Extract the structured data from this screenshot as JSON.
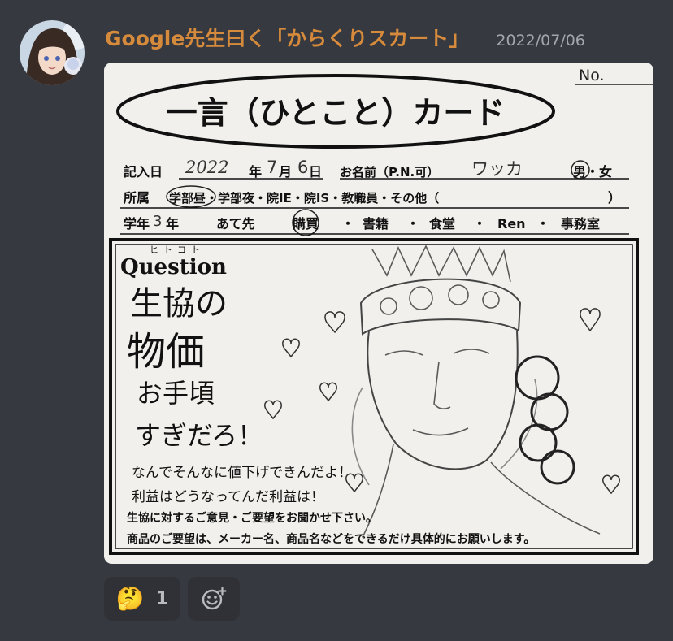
{
  "message": {
    "author": "Google先生曰く「からくりスカート」",
    "timestamp": "2022/07/06"
  },
  "card": {
    "no_label": "No.",
    "title": "一言（ひとこと）カード",
    "date_label": "記入日",
    "year_value": "2022",
    "year_label": "年",
    "month_value": "7",
    "month_label": "月",
    "day_value": "6",
    "day_label": "日",
    "name_label": "お名前（P.N.可）",
    "name_value": "ワッカ",
    "gender_options": "男・女",
    "affiliation_label": "所属",
    "affiliation_options": "学部昼・学部夜・院IE・院IS・教職員・その他（",
    "affiliation_close": "）",
    "grade_label": "学年",
    "grade_value": "3",
    "grade_unit": "年",
    "recipient_label": "あて先",
    "recipient_options": [
      "購買",
      "書籍",
      "食堂",
      "Ren",
      "事務室"
    ],
    "question_ruby": "ヒトコト",
    "question_label": "Question",
    "handwriting_lines": [
      "生協の",
      "物価",
      "お手頃",
      "すぎだろ！"
    ],
    "handwriting_small": [
      "なんでそんなに値下げできんだよ！",
      "利益はどうなってんだ利益は！"
    ],
    "footer_lines": [
      "生協に対するご意見・ご要望をお聞かせ下さい。",
      "商品のご要望は、メーカー名、商品名などをできるだけ具体的にお願いします。"
    ]
  },
  "reactions": [
    {
      "icon": "thinking-face-icon",
      "emoji": "🤔",
      "count": "1"
    }
  ],
  "colors": {
    "background": "#36393f",
    "username": "#d68a3b",
    "timestamp": "#a3a6aa",
    "reaction_bg": "#2f3136"
  }
}
